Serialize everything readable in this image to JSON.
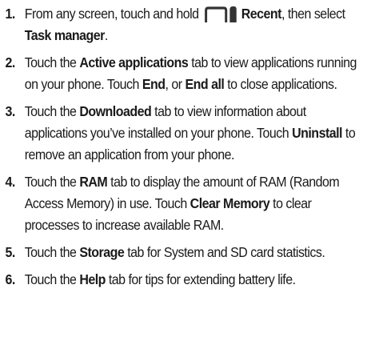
{
  "steps": [
    {
      "number": "1.",
      "t1": "From any screen, touch and hold ",
      "icon": "recent-apps-icon",
      "b1": "Recent",
      "t2": ", then select ",
      "b2": "Task manager",
      "t3": "."
    },
    {
      "number": "2.",
      "t1": "Touch the ",
      "b1": "Active applications",
      "t2": " tab to view applications running on your phone. Touch ",
      "b2": "End",
      "t3": ", or ",
      "b3": "End all",
      "t4": " to close applications."
    },
    {
      "number": "3.",
      "t1": "Touch the ",
      "b1": "Downloaded",
      "t2": " tab to view information about applications you’ve installed on your phone. Touch ",
      "b2": "Uninstall",
      "t3": " to remove an application from your phone."
    },
    {
      "number": "4.",
      "t1": "Touch the ",
      "b1": "RAM",
      "t2": " tab to display the amount of RAM (Random Access Memory) in use. Touch ",
      "b2": "Clear Memory",
      "t3": " to clear processes to increase available RAM."
    },
    {
      "number": "5.",
      "t1": "Touch the ",
      "b1": "Storage",
      "t2": " tab for System and SD card statistics."
    },
    {
      "number": "6.",
      "t1": "Touch the ",
      "b1": "Help",
      "t2": " tab for tips for extending battery life."
    }
  ],
  "icon_color": "#333333"
}
